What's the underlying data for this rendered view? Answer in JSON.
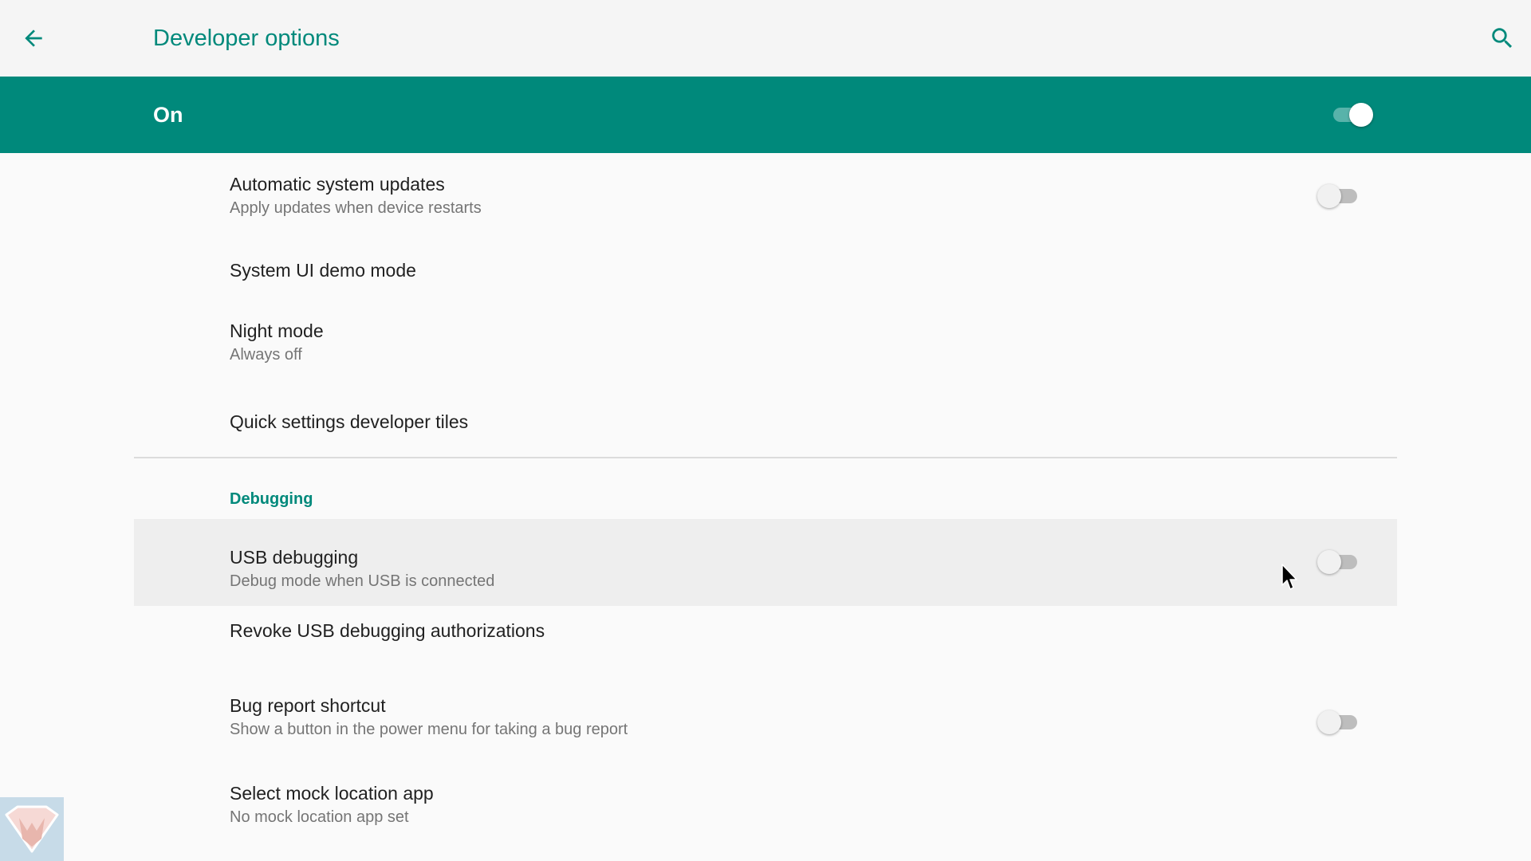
{
  "appbar": {
    "title": "Developer options",
    "back_icon": "arrow-back-icon",
    "search_icon": "search-icon"
  },
  "master": {
    "label": "On",
    "checked": true
  },
  "items": [
    {
      "title": "Automatic system updates",
      "summary": "Apply updates when device restarts",
      "toggle": false
    },
    {
      "title": "System UI demo mode"
    },
    {
      "title": "Night mode",
      "summary": "Always off"
    },
    {
      "title": "Quick settings developer tiles"
    }
  ],
  "debugging": {
    "header": "Debugging",
    "items": [
      {
        "title": "USB debugging",
        "summary": "Debug mode when USB is connected",
        "toggle": false
      },
      {
        "title": "Revoke USB debugging authorizations"
      },
      {
        "title": "Bug report shortcut",
        "summary": "Show a button in the power menu for taking a bug report",
        "toggle": false
      },
      {
        "title": "Select mock location app",
        "summary": "No mock location app set"
      }
    ]
  },
  "colors": {
    "accent": "#00897b",
    "appbar_bg": "#f5f5f5",
    "page_bg": "#fafafa",
    "highlight_bg": "#eeeeee"
  }
}
